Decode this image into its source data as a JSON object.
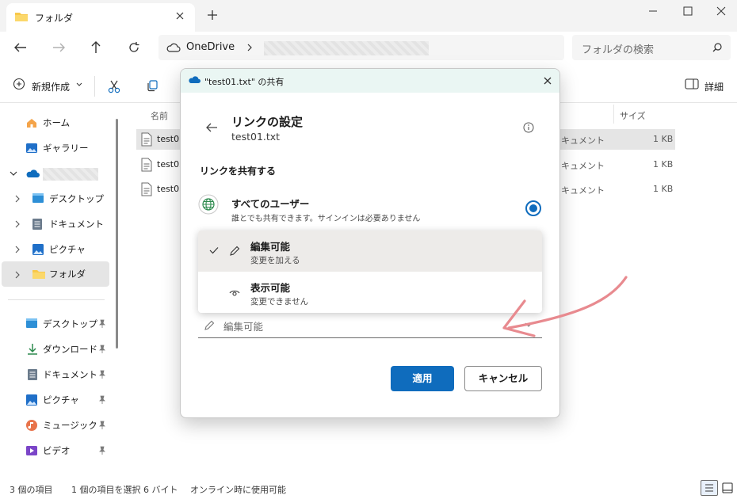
{
  "window": {
    "tab_title": "フォルダ",
    "new_tab_icon": "plus-icon"
  },
  "navigation": {
    "address_root": "OneDrive",
    "search_placeholder": "フォルダの検索"
  },
  "toolbar": {
    "new_label": "新規作成",
    "details_label": "詳細"
  },
  "sidebar": {
    "items": [
      {
        "label": "ホーム",
        "icon": "home-icon"
      },
      {
        "label": "ギャラリー",
        "icon": "gallery-icon"
      },
      {
        "label": "",
        "icon": "onedrive-icon"
      },
      {
        "label": "デスクトップ",
        "icon": "desktop-icon"
      },
      {
        "label": "ドキュメント",
        "icon": "document-icon"
      },
      {
        "label": "ピクチャ",
        "icon": "pictures-icon"
      },
      {
        "label": "フォルダ",
        "icon": "folder-icon"
      }
    ],
    "quick_access": [
      {
        "label": "デスクトップ",
        "icon": "desktop-icon"
      },
      {
        "label": "ダウンロード",
        "icon": "download-icon"
      },
      {
        "label": "ドキュメント",
        "icon": "document-icon"
      },
      {
        "label": "ピクチャ",
        "icon": "pictures-icon"
      },
      {
        "label": "ミュージック",
        "icon": "music-icon"
      },
      {
        "label": "ビデオ",
        "icon": "video-icon"
      }
    ]
  },
  "file_list": {
    "columns": {
      "name": "名前",
      "size": "サイズ"
    },
    "rows": [
      {
        "name": "test01",
        "type": "キュメント",
        "size": "1 KB"
      },
      {
        "name": "test02",
        "type": "キュメント",
        "size": "1 KB"
      },
      {
        "name": "test03",
        "type": "キュメント",
        "size": "1 KB"
      }
    ]
  },
  "status": {
    "item_count": "3 個の項目",
    "selection": "1 個の項目を選択 6 バイト",
    "availability": "オンライン時に使用可能"
  },
  "dialog": {
    "title": "\"test01.txt\" の共有",
    "heading": "リンクの設定",
    "subtitle": "test01.txt",
    "share_section_label": "リンクを共有する",
    "scope": {
      "title": "すべてのユーザー",
      "description": "誰とでも共有できます。サインインは必要ありません"
    },
    "permissions": [
      {
        "title": "編集可能",
        "description": "変更を加える",
        "selected": true,
        "icon": "pencil-icon"
      },
      {
        "title": "表示可能",
        "description": "変更できません",
        "selected": false,
        "icon": "eye-icon"
      }
    ],
    "permission_value": "編集可能",
    "apply_label": "適用",
    "cancel_label": "キャンセル"
  },
  "colors": {
    "accent": "#0f6cbd",
    "annotation_arrow": "#e88a8f",
    "dialog_title_bg": "#eaf6f3"
  }
}
